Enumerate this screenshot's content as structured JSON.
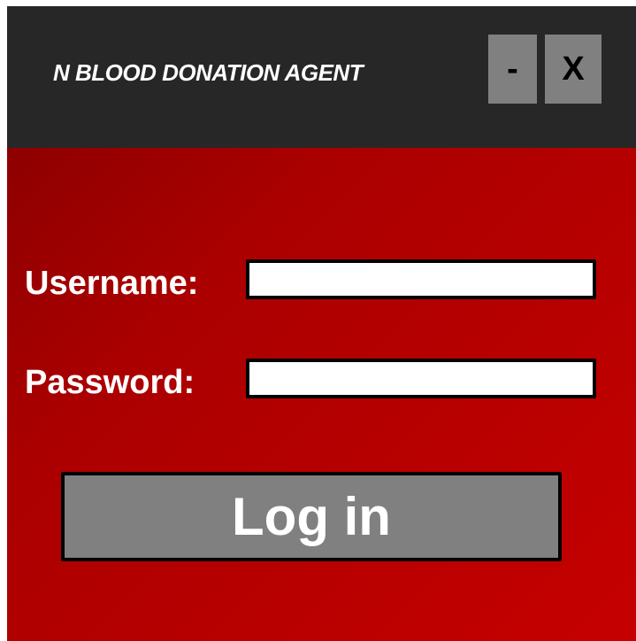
{
  "window": {
    "title": "N BLOOD DONATION AGENT",
    "minimize_label": "-",
    "close_label": "X"
  },
  "form": {
    "username_label": "Username:",
    "username_value": "",
    "password_label": "Password:",
    "password_value": "",
    "login_label": "Log in"
  },
  "colors": {
    "titlebar": "#272727",
    "window_button": "#808080",
    "panel_dark_red": "#8e0000",
    "panel_bright_red": "#c60000",
    "login_button": "#808080"
  }
}
